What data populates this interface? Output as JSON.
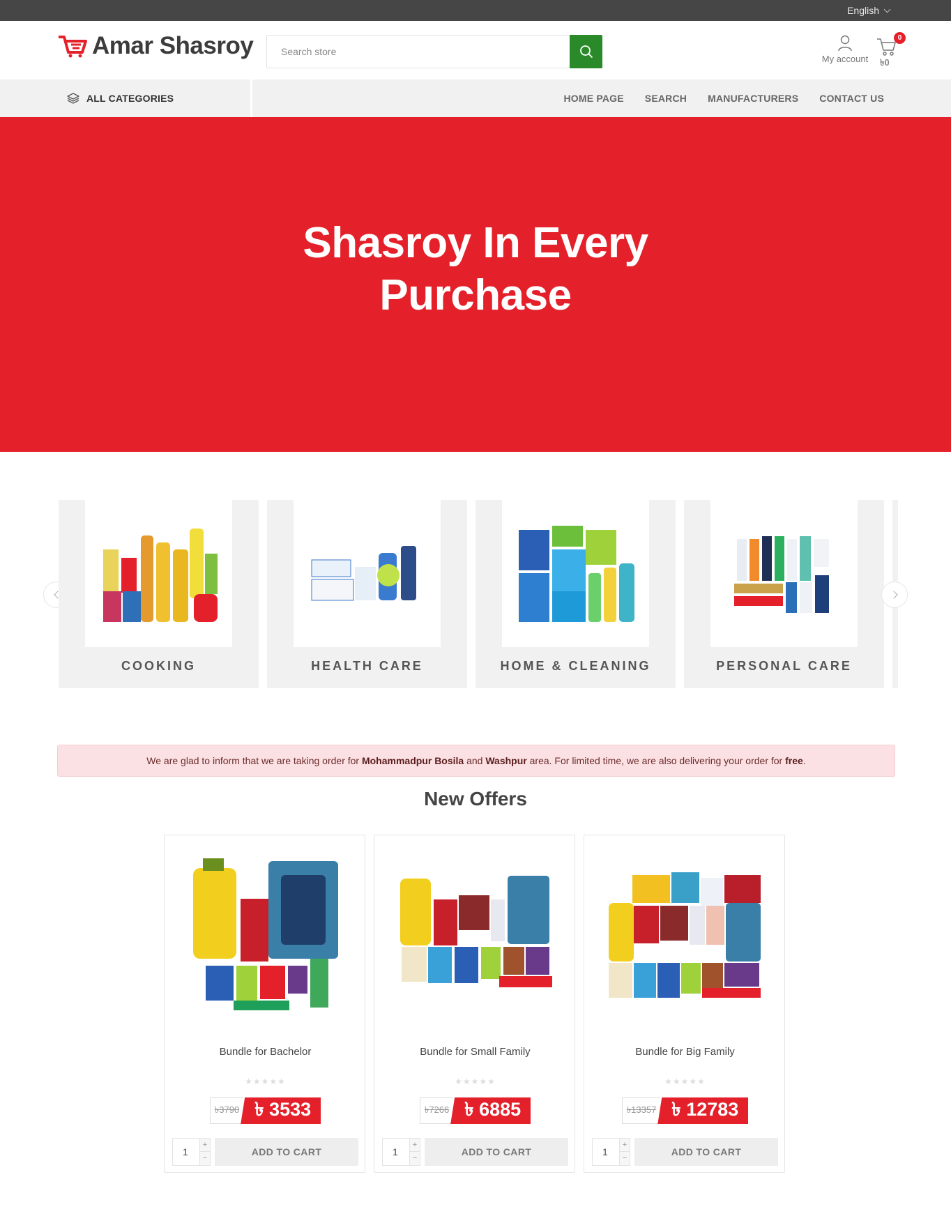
{
  "topbar": {
    "language": "English"
  },
  "header": {
    "logo_text": "Amar Shasroy",
    "search_placeholder": "Search store",
    "account_label": "My account",
    "cart_count": "0",
    "cart_total": "৳0"
  },
  "nav": {
    "all_categories": "ALL CATEGORIES",
    "links": [
      "HOME PAGE",
      "SEARCH",
      "MANUFACTURERS",
      "CONTACT US"
    ]
  },
  "hero": {
    "title": "Shasroy In Every Purchase"
  },
  "categories": [
    {
      "label": "COOKING"
    },
    {
      "label": "HEALTH CARE"
    },
    {
      "label": "HOME & CLEANING"
    },
    {
      "label": "PERSONAL CARE"
    }
  ],
  "notice": {
    "p1": "We are glad to inform that we are taking order for ",
    "b1": "Mohammadpur Bosila",
    "p2": " and ",
    "b2": "Washpur",
    "p3": " area. For limited time, we are also delivering your order for ",
    "b3": "free",
    "p4": "."
  },
  "offers": {
    "title": "New Offers",
    "products": [
      {
        "name": "Bundle for Bachelor",
        "old_price": "৳3790",
        "price": "৳ 3533",
        "qty": "1",
        "button": "ADD TO CART",
        "rating": 0
      },
      {
        "name": "Bundle for Small Family",
        "old_price": "৳7266",
        "price": "৳ 6885",
        "qty": "1",
        "button": "ADD TO CART",
        "rating": 0
      },
      {
        "name": "Bundle for Big Family",
        "old_price": "৳13357",
        "price": "৳ 12783",
        "qty": "1",
        "button": "ADD TO CART",
        "rating": 0
      }
    ]
  },
  "colors": {
    "brand_red": "#e4202a",
    "search_green": "#2a8a2a",
    "topbar": "#464646"
  },
  "icons": [
    "cart-logo-icon",
    "search-icon",
    "user-icon",
    "cart-icon",
    "layers-icon",
    "chevron-down-icon",
    "chevron-left-icon",
    "chevron-right-icon",
    "star-icon"
  ]
}
